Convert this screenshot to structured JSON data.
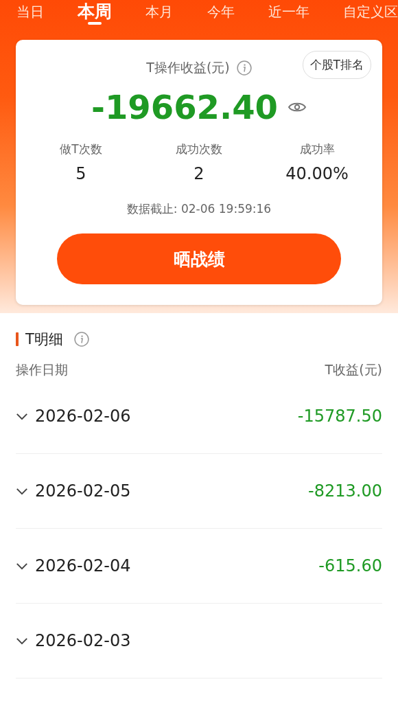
{
  "tabs": [
    {
      "label": "当日",
      "selected": false
    },
    {
      "label": "本周",
      "selected": true
    },
    {
      "label": "本月",
      "selected": false
    },
    {
      "label": "今年",
      "selected": false
    },
    {
      "label": "近一年",
      "selected": false
    },
    {
      "label": "自定义区",
      "selected": false
    }
  ],
  "summary": {
    "title": "T操作收益(元)",
    "ranking_button": "个股T排名",
    "total": "-19662.40",
    "stats": [
      {
        "label": "做T次数",
        "value": "5"
      },
      {
        "label": "成功次数",
        "value": "2"
      },
      {
        "label": "成功率",
        "value": "40.00%"
      }
    ],
    "timestamp": "数据截止: 02-06 19:59:16",
    "share_button": "晒战绩"
  },
  "detail": {
    "title": "T明细",
    "columns": [
      "操作日期",
      "T收益(元)"
    ],
    "rows": [
      {
        "date": "2026-02-06",
        "profit": "-15787.50",
        "expanded": false
      },
      {
        "date": "2026-02-05",
        "profit": "-8213.00",
        "expanded": false
      },
      {
        "date": "2026-02-04",
        "profit": "-615.60",
        "expanded": false
      },
      {
        "date": "2026-02-03",
        "expanded": false
      }
    ]
  }
}
